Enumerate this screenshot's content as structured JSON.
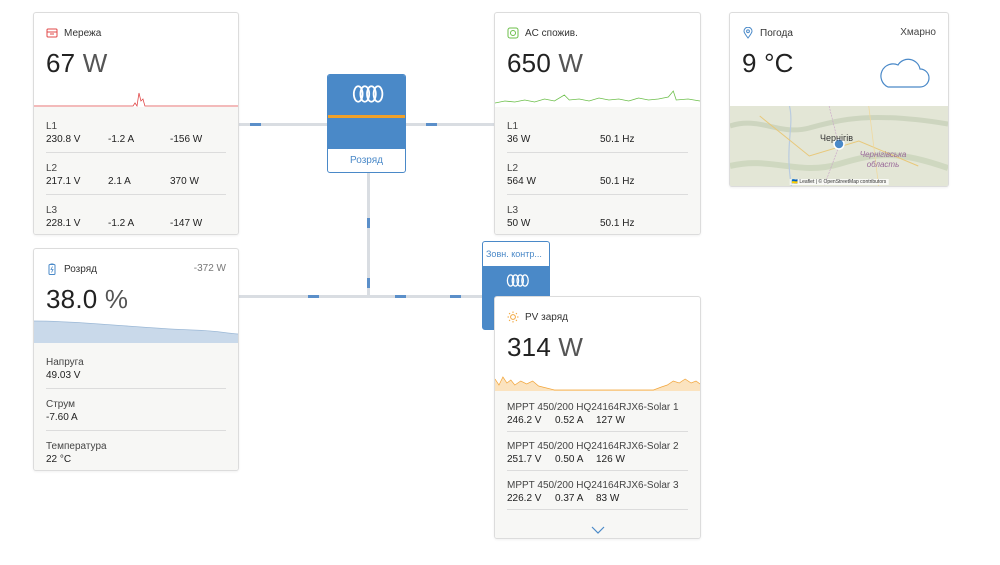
{
  "grid": {
    "title": "Мережа",
    "power_value": "67",
    "power_unit": "W",
    "phases": [
      {
        "label": "L1",
        "voltage": "230.8 V",
        "current": "-1.2 A",
        "power": "-156 W"
      },
      {
        "label": "L2",
        "voltage": "217.1 V",
        "current": "2.1 A",
        "power": "370 W"
      },
      {
        "label": "L3",
        "voltage": "228.1 V",
        "current": "-1.2 A",
        "power": "-147 W"
      }
    ]
  },
  "inverter": {
    "status": "Розряд"
  },
  "ac_loads": {
    "title": "AC спожив.",
    "power_value": "650",
    "power_unit": "W",
    "phases": [
      {
        "label": "L1",
        "power": "36 W",
        "frequency": "50.1 Hz"
      },
      {
        "label": "L2",
        "power": "564 W",
        "frequency": "50.1 Hz"
      },
      {
        "label": "L3",
        "power": "50 W",
        "frequency": "50.1 Hz"
      }
    ]
  },
  "weather": {
    "title": "Погода",
    "condition": "Хмарно",
    "temperature": "9 °C",
    "map_city": "Чернігів",
    "map_region": "Чернігівська область",
    "map_attribution": "🇺🇦 Leaflet | © OpenStreetMap contributors"
  },
  "battery": {
    "title": "Розряд",
    "power": "-372 W",
    "soc_value": "38.0",
    "soc_unit": "%",
    "details": [
      {
        "label": "Напруга",
        "value": "49.03 V"
      },
      {
        "label": "Струм",
        "value": "-7.60 A"
      },
      {
        "label": "Температура",
        "value": "22 °C"
      }
    ]
  },
  "external_control": {
    "label": "Зовн. контр..."
  },
  "pv": {
    "title": "PV заряд",
    "power_value": "314",
    "power_unit": "W",
    "chargers": [
      {
        "name": "MPPT 450/200 HQ24164RJX6-Solar 1",
        "voltage": "246.2 V",
        "current": "0.52 A",
        "power": "127 W"
      },
      {
        "name": "MPPT 450/200 HQ24164RJX6-Solar 2",
        "voltage": "251.7 V",
        "current": "0.50 A",
        "power": "126 W"
      },
      {
        "name": "MPPT 450/200 HQ24164RJX6-Solar 3",
        "voltage": "226.2 V",
        "current": "0.37 A",
        "power": "83 W"
      }
    ]
  },
  "colors": {
    "accent_blue": "#4a89c8",
    "accent_orange": "#f0a028",
    "grid_red": "#e04848",
    "ac_green": "#6cbf4a",
    "pv_orange": "#f2a53a"
  },
  "icons": {
    "grid": "grid-icon",
    "ac": "ac-loads-icon",
    "weather": "location-pin-icon",
    "cloud": "cloud-icon",
    "battery": "battery-icon",
    "pv": "sun-icon",
    "expand": "chevron-down-icon",
    "logo": "victron-logo"
  }
}
